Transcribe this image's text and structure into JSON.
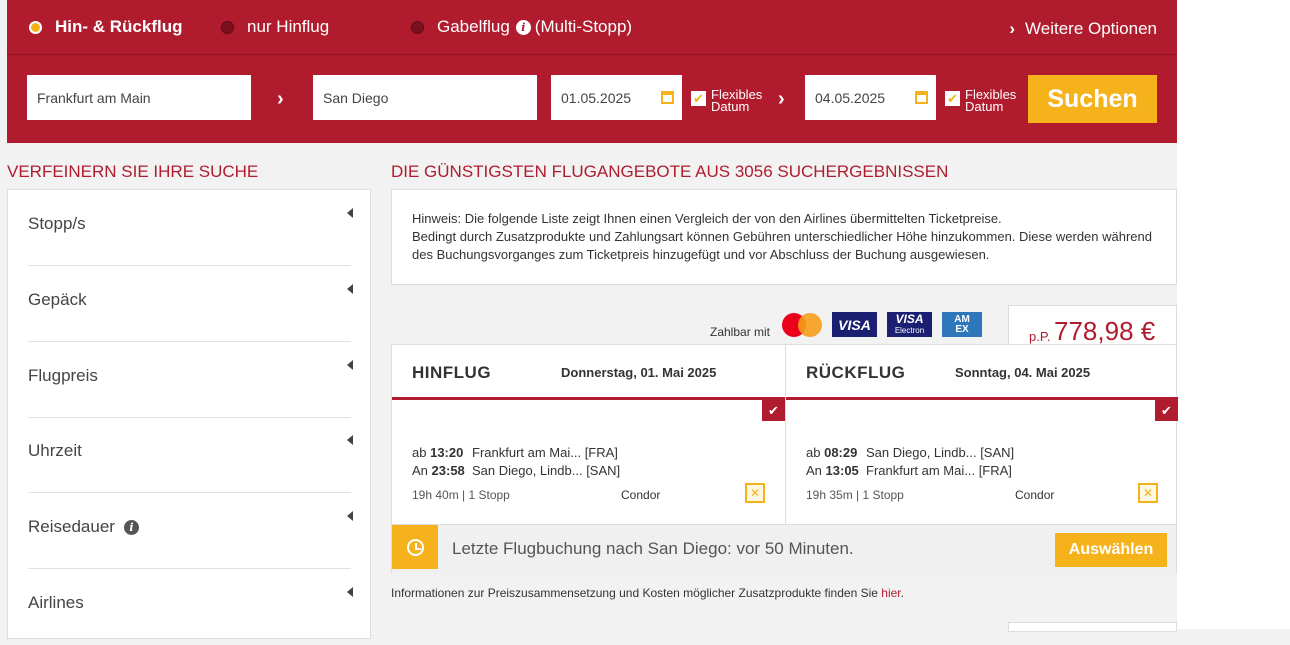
{
  "search": {
    "trip_types": [
      {
        "label": "Hin- & Rückflug",
        "active": true
      },
      {
        "label": "nur Hinflug",
        "active": false
      },
      {
        "label": "Gabelflug",
        "suffix": "(Multi-Stopp)",
        "active": false
      }
    ],
    "more_options": "Weitere Optionen",
    "from": "Frankfurt am Main",
    "to": "San Diego",
    "depart_date": "01.05.2025",
    "return_date": "04.05.2025",
    "flexible_line1": "Flexibles",
    "flexible_line2": "Datum",
    "search_button": "Suchen",
    "info_glyph": "i"
  },
  "sidebar": {
    "title": "VERFEINERN SIE IHRE SUCHE",
    "filters": [
      {
        "label": "Stopp/s",
        "info": false
      },
      {
        "label": "Gepäck",
        "info": false
      },
      {
        "label": "Flugpreis",
        "info": false
      },
      {
        "label": "Uhrzeit",
        "info": false
      },
      {
        "label": "Reisedauer",
        "info": true
      },
      {
        "label": "Airlines",
        "info": false
      }
    ]
  },
  "results": {
    "title": "DIE GÜNSTIGSTEN FLUGANGEBOTE AUS 3056 SUCHERGEBNISSEN",
    "notice_line1": "Hinweis: Die folgende Liste zeigt Ihnen einen Vergleich der von den Airlines übermittelten Ticketpreise.",
    "notice_line2": "Bedingt durch Zusatzprodukte und Zahlungsart können Gebühren unterschiedlicher Höhe hinzukommen. Diese werden während des Buchungsvorganges zum Ticketpreis hinzugefügt und vor Abschluss der Buchung ausgewiesen.",
    "pay_label": "Zahlbar mit",
    "cards": [
      "VISA",
      "VISA",
      "Electron",
      "AM",
      "EX"
    ],
    "price_prefix": "p.P.",
    "price": "778,98 €",
    "outbound": {
      "title": "HINFLUG",
      "date": "Donnerstag, 01. Mai 2025",
      "dep_prefix": "ab",
      "dep_time": "13:20",
      "dep_place": "Frankfurt am Mai... [FRA]",
      "arr_prefix": "An",
      "arr_time": "23:58",
      "arr_place": "San Diego, Lindb... [SAN]",
      "duration": "19h 40m | 1 Stopp",
      "airline": "Condor"
    },
    "inbound": {
      "title": "RÜCKFLUG",
      "date": "Sonntag, 04. Mai 2025",
      "dep_prefix": "ab",
      "dep_time": "08:29",
      "dep_place": "San Diego, Lindb... [SAN]",
      "arr_prefix": "An",
      "arr_time": "13:05",
      "arr_place": "Frankfurt am Mai... [FRA]",
      "duration": "19h 35m | 1 Stopp",
      "airline": "Condor"
    },
    "last_booking": "Letzte Flugbuchung nach San Diego: vor 50 Minuten.",
    "select_button": "Auswählen",
    "info_text": "Informationen zur Preiszusammensetzung und Kosten möglicher Zusatzprodukte finden Sie ",
    "info_link": "hier",
    "info_end": "."
  },
  "colors": {
    "brand": "#b01c2e",
    "accent": "#f5b21a"
  }
}
